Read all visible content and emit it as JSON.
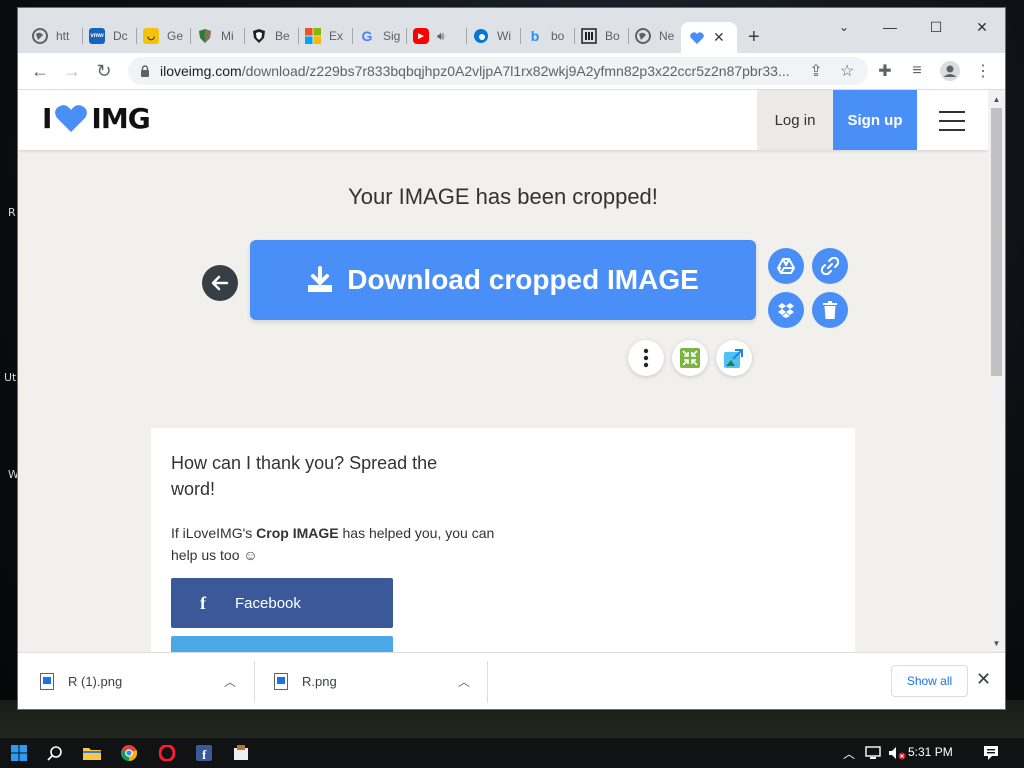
{
  "desktop": {
    "labels": [
      "R",
      "Uti",
      "W"
    ]
  },
  "browser": {
    "tabs": [
      {
        "title": "htt",
        "icon": "globe-icon",
        "color": "#5f6368"
      },
      {
        "title": "Dc",
        "icon": "vmware-icon",
        "color": "#1565c0"
      },
      {
        "title": "Ge",
        "icon": "smiley-icon",
        "color": "#f4c20d"
      },
      {
        "title": "Mi",
        "icon": "shield-green-icon",
        "color": "#2e7d32"
      },
      {
        "title": "Be",
        "icon": "shield-icon",
        "color": "#202124"
      },
      {
        "title": "Ex",
        "icon": "microsoft-icon",
        "color": "#f25022"
      },
      {
        "title": "Sig",
        "icon": "google-icon",
        "color": "#4285f4"
      },
      {
        "title": "",
        "icon": "youtube-icon",
        "color": "#ff0000"
      },
      {
        "title": "Wi",
        "icon": "edge-icon",
        "color": "#0078d4"
      },
      {
        "title": "bo",
        "icon": "bing-icon",
        "color": "#258ffa"
      },
      {
        "title": "Bo",
        "icon": "library-icon",
        "color": "#202124"
      },
      {
        "title": "Ne",
        "icon": "globe-icon",
        "color": "#5f6368"
      }
    ],
    "active_tab_icon": "heart-icon",
    "url_host": "iloveimg.com",
    "url_rest": "/download/z229bs7r833bqbqjhpz0A2vljpA7l1rx82wkj9A2yfmn82p3x22ccr5z2n87pbr33..."
  },
  "site": {
    "logo_left": "I",
    "logo_right": "IMG",
    "login": "Log in",
    "signup": "Sign up",
    "headline": "Your IMAGE has been cropped!",
    "download_label": "Download cropped IMAGE",
    "share_title": "How can I thank you? Spread the word!",
    "share_text_pre": "If iLoveIMG's ",
    "share_text_bold": "Crop IMAGE",
    "share_text_post": " has helped you, you can help us too ☺",
    "facebook_label": "Facebook",
    "accent_color": "#4a8ef7",
    "facebook_color": "#3b5998"
  },
  "downloads": {
    "items": [
      {
        "name": "R (1).png"
      },
      {
        "name": "R.png"
      }
    ],
    "show_all": "Show all"
  },
  "taskbar": {
    "time": "5:31 PM"
  }
}
